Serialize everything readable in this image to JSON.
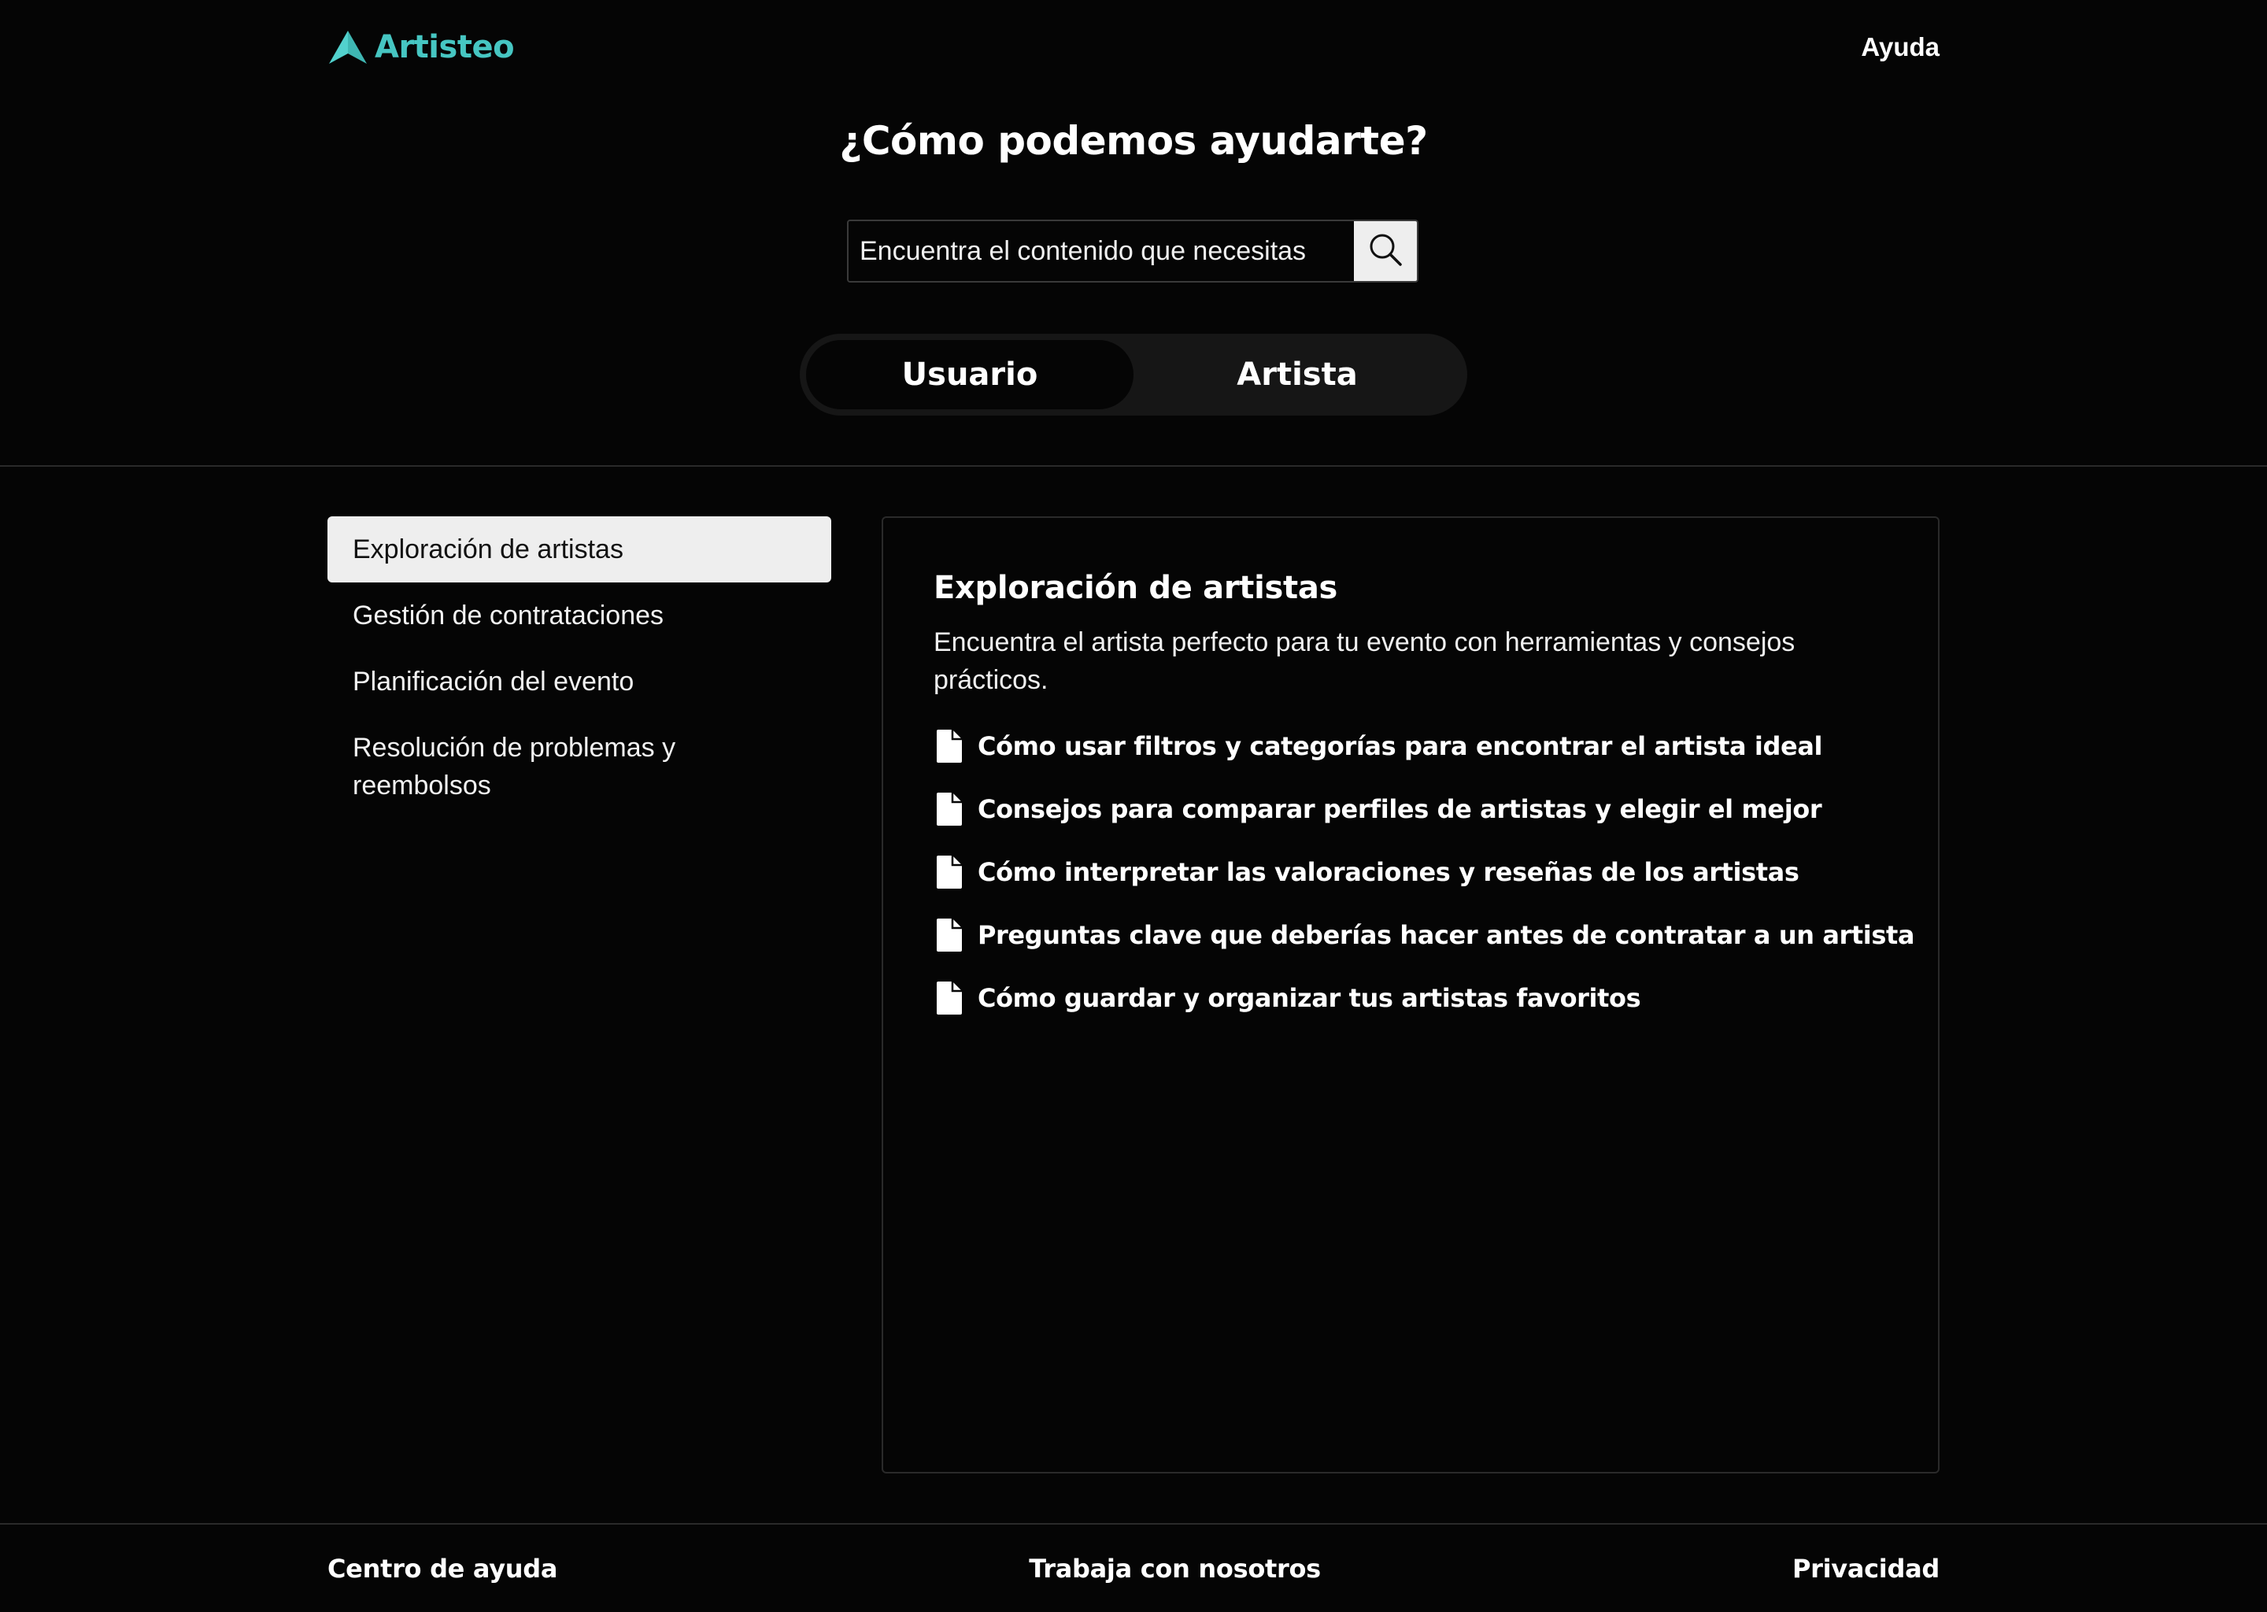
{
  "header": {
    "brand_name": "Artisteo",
    "brand_color": "#46c6c2",
    "help_label": "Ayuda"
  },
  "hero": {
    "title": "¿Cómo podemos ayudarte?"
  },
  "search": {
    "placeholder": "Encuentra el contenido que necesitas",
    "value": "",
    "icon": "search-icon"
  },
  "toggle": {
    "options": [
      {
        "label": "Usuario",
        "selected": true
      },
      {
        "label": "Artista",
        "selected": false
      }
    ]
  },
  "sidebar": {
    "items": [
      {
        "label": "Exploración de artistas",
        "selected": true
      },
      {
        "label": "Gestión de contrataciones",
        "selected": false
      },
      {
        "label": "Planificación del evento",
        "selected": false
      },
      {
        "label": "Resolución de problemas y reembolsos",
        "selected": false
      }
    ]
  },
  "content": {
    "title": "Exploración de artistas",
    "description": "Encuentra el artista perfecto para tu evento con herramientas y consejos prácticos.",
    "articles": [
      {
        "label": "Cómo usar filtros y categorías para encontrar el artista ideal",
        "icon": "document-icon"
      },
      {
        "label": "Consejos para comparar perfiles de artistas y elegir el mejor",
        "icon": "document-icon"
      },
      {
        "label": "Cómo interpretar las valoraciones y reseñas de los artistas",
        "icon": "document-icon"
      },
      {
        "label": "Preguntas clave que deberías hacer antes de contratar a un artista",
        "icon": "document-icon"
      },
      {
        "label": "Cómo guardar y organizar tus artistas favoritos",
        "icon": "document-icon"
      }
    ]
  },
  "footer": {
    "links": [
      {
        "label": "Centro de ayuda"
      },
      {
        "label": "Trabaja con nosotros"
      },
      {
        "label": "Privacidad"
      }
    ]
  }
}
